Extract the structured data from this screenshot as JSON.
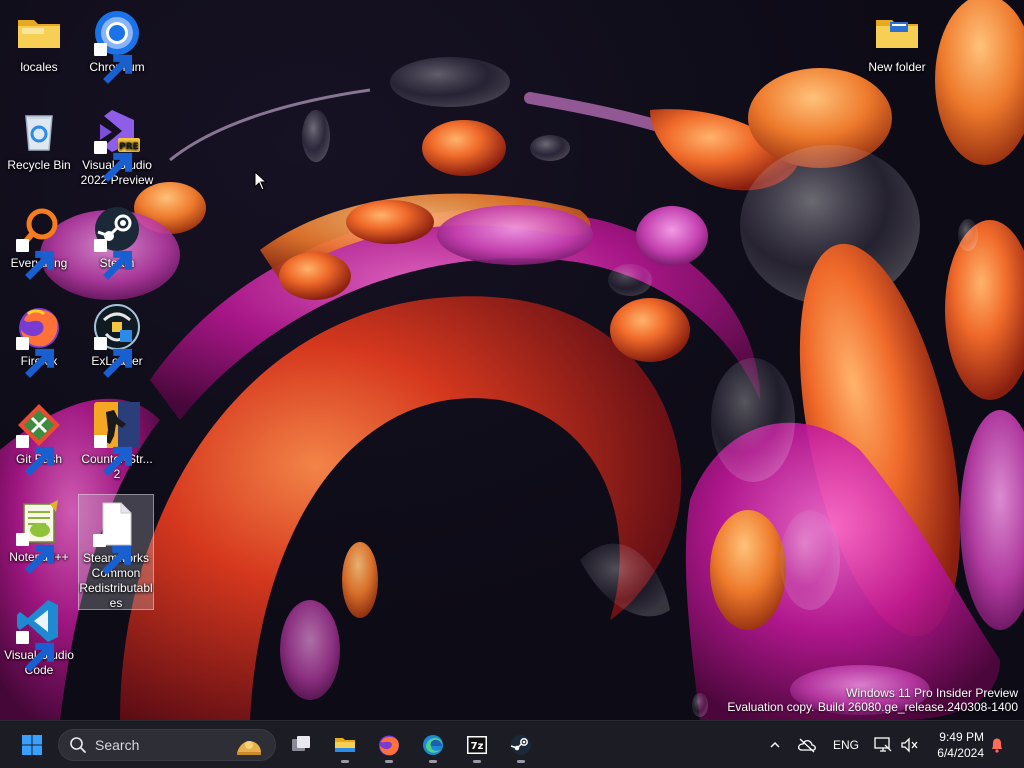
{
  "desktop": {
    "icons": [
      {
        "label": "locales",
        "icon": "folder-icon"
      },
      {
        "label": "Chromium",
        "icon": "chromium-icon"
      },
      {
        "label": "Recycle Bin",
        "icon": "recycle-bin-icon"
      },
      {
        "label": "Visual Studio 2022 Preview",
        "icon": "visual-studio-preview-icon",
        "badge": "PRE"
      },
      {
        "label": "Everything",
        "icon": "everything-search-icon"
      },
      {
        "label": "Steam",
        "icon": "steam-icon"
      },
      {
        "label": "Firefox",
        "icon": "firefox-icon"
      },
      {
        "label": "ExLoader",
        "icon": "exloader-icon"
      },
      {
        "label": "Git Bash",
        "icon": "git-bash-icon"
      },
      {
        "label": "Counter-Str... 2",
        "icon": "counter-strike-icon"
      },
      {
        "label": "Notepad++",
        "icon": "notepad-plus-plus-icon"
      },
      {
        "label": "Steamworks Common Redistributables",
        "icon": "document-file-icon",
        "selected": true
      },
      {
        "label": "Visual Studio Code",
        "icon": "vscode-icon"
      },
      {
        "label": "New folder",
        "icon": "folder-icon"
      }
    ]
  },
  "watermark": {
    "line1": "Windows 11 Pro Insider Preview",
    "line2": "Evaluation copy. Build 26080.ge_release.240308-1400"
  },
  "taskbar": {
    "search_placeholder": "Search",
    "pinned": [
      {
        "name": "task-view",
        "icon": "task-view-icon",
        "running": false
      },
      {
        "name": "file-explorer",
        "icon": "file-explorer-icon",
        "running": true
      },
      {
        "name": "firefox",
        "icon": "firefox-icon",
        "running": true
      },
      {
        "name": "edge",
        "icon": "edge-icon",
        "running": true
      },
      {
        "name": "7zip",
        "icon": "7zip-icon",
        "running": true
      },
      {
        "name": "steam",
        "icon": "steam-icon",
        "running": true
      }
    ],
    "tray": {
      "language": "ENG",
      "time": "9:49 PM",
      "date": "6/4/2024"
    }
  },
  "colors": {
    "taskbar_bg": "#1c1c24",
    "win_blue": "#3aa0ff",
    "folder_yellow": "#f4c542",
    "notification": "#ff6d5a"
  }
}
